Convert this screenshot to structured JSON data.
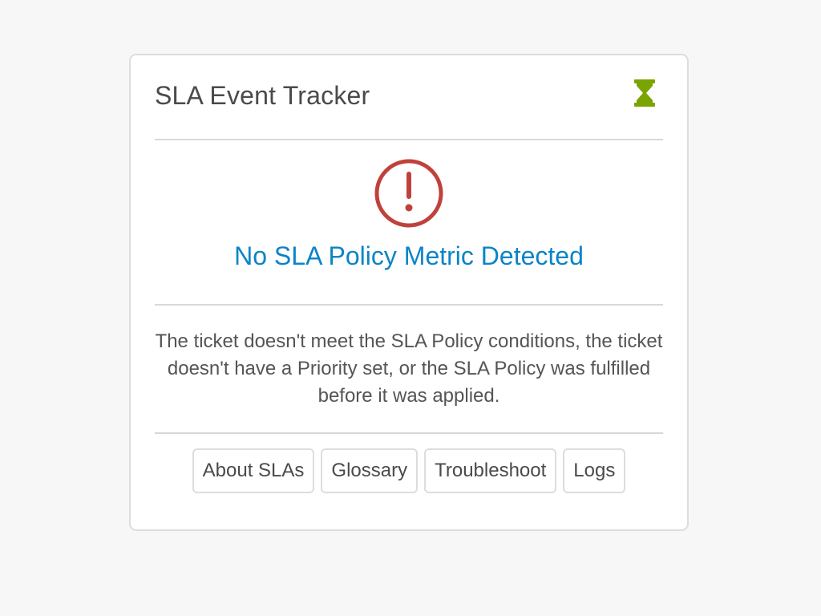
{
  "widget": {
    "title": "SLA Event Tracker",
    "header_icon": "hourglass-icon",
    "accent_color": "#7aa400"
  },
  "status": {
    "icon": "alert-circle-icon",
    "icon_color": "#c0413b",
    "title": "No SLA Policy Metric Detected",
    "title_color": "#0b84c6"
  },
  "description": {
    "text": "The ticket doesn't meet the SLA Policy conditions, the ticket doesn't have a Priority set, or the SLA Policy was fulfilled before it was applied."
  },
  "buttons": [
    {
      "label": "About SLAs"
    },
    {
      "label": "Glossary"
    },
    {
      "label": "Troubleshoot"
    },
    {
      "label": "Logs"
    }
  ]
}
